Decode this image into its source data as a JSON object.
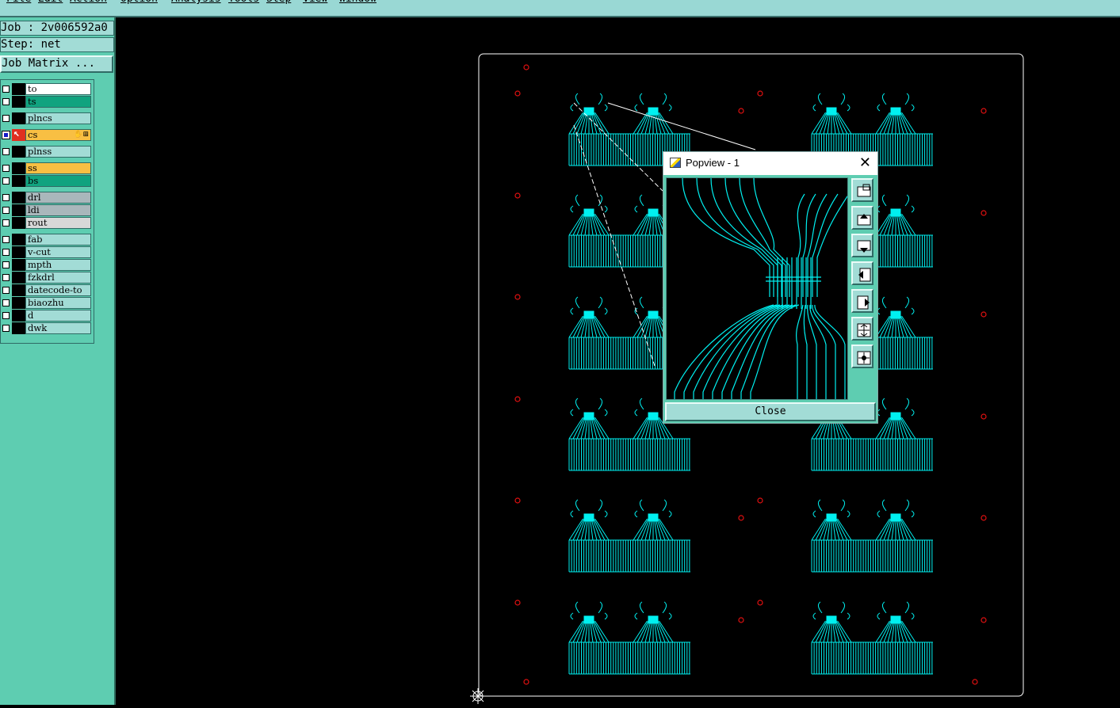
{
  "menu": {
    "items": [
      "File",
      "Edit",
      "Action",
      "Option",
      "Analysis",
      "Tools",
      "Step",
      "View",
      "Window"
    ]
  },
  "job_label": "Job : 2v006592a0",
  "step_label": "Step: net",
  "job_matrix_label": "Job Matrix ...",
  "layers": [
    {
      "name": "to",
      "color": "#ffffff"
    },
    {
      "name": "ts",
      "color": "#10a37f"
    },
    {
      "name": "plncs",
      "color": "#a2dcd6"
    },
    {
      "name": "cs",
      "color": "#f8bf43",
      "selected": true
    },
    {
      "name": "plnss",
      "color": "#a2dcd6"
    },
    {
      "name": "ss",
      "color": "#f8bf43"
    },
    {
      "name": "bs",
      "color": "#10a37f"
    },
    {
      "name": "drl",
      "color": "#a9b7bb"
    },
    {
      "name": "ldi",
      "color": "#a9b7bb"
    },
    {
      "name": "rout",
      "color": "#d8d8d8"
    },
    {
      "name": "fab",
      "color": "#a2dcd6"
    },
    {
      "name": "v-cut",
      "color": "#a2dcd6"
    },
    {
      "name": "mpth",
      "color": "#a2dcd6"
    },
    {
      "name": "fzkdrl",
      "color": "#a2dcd6"
    },
    {
      "name": "datecode-to",
      "color": "#a2dcd6"
    },
    {
      "name": "biaozhu",
      "color": "#a2dcd6"
    },
    {
      "name": "d",
      "color": "#a2dcd6"
    },
    {
      "name": "dwk",
      "color": "#a2dcd6"
    }
  ],
  "popview": {
    "title": "Popview - 1",
    "close_label": "Close",
    "tools": [
      "zoom-window-icon",
      "pan-up-icon",
      "pan-down-icon",
      "pan-left-icon",
      "pan-right-icon",
      "zoom-fit-icon",
      "zoom-home-icon"
    ]
  },
  "colors": {
    "trace": "#00f0f0",
    "drill_mark": "#e01010",
    "profile": "#ffffff",
    "panel_bg": "#5ecdb1"
  }
}
